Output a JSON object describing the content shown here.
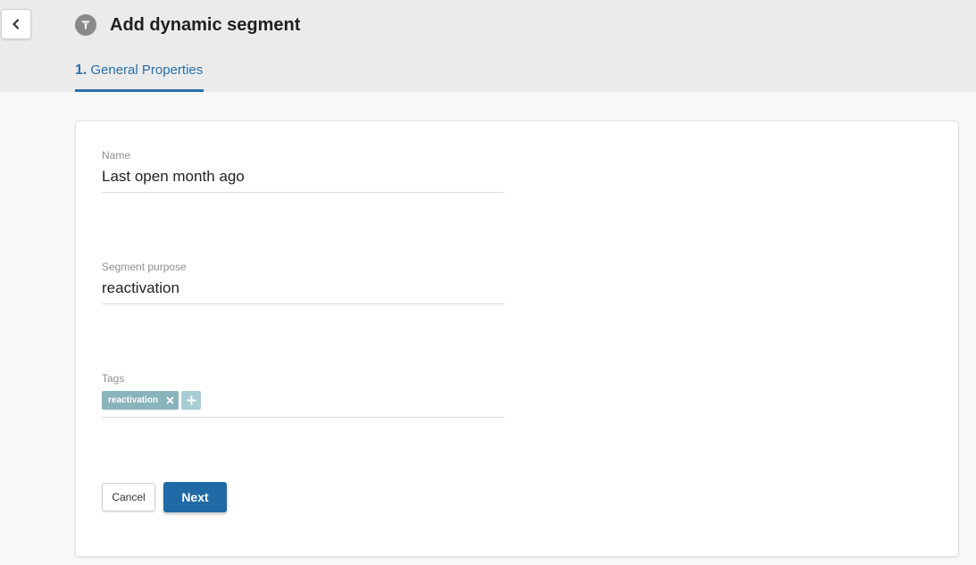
{
  "header": {
    "title": "Add dynamic segment",
    "title_icon": "funnel-icon",
    "back_icon": "chevron-left-icon",
    "steps": [
      {
        "number": "1.",
        "label": "General Properties",
        "active": true
      }
    ]
  },
  "form": {
    "name": {
      "label": "Name",
      "value": "Last open month ago"
    },
    "purpose": {
      "label": "Segment purpose",
      "value": "reactivation"
    },
    "tags": {
      "label": "Tags",
      "items": [
        "reactivation"
      ],
      "remove_icon": "close-icon",
      "add_icon": "plus-icon"
    }
  },
  "actions": {
    "cancel_label": "Cancel",
    "next_label": "Next"
  },
  "colors": {
    "accent": "#1f6aa5",
    "tab_active": "#2a6fa8",
    "tag_chip": "#8ab4bc",
    "header_bg": "#ebebeb"
  }
}
